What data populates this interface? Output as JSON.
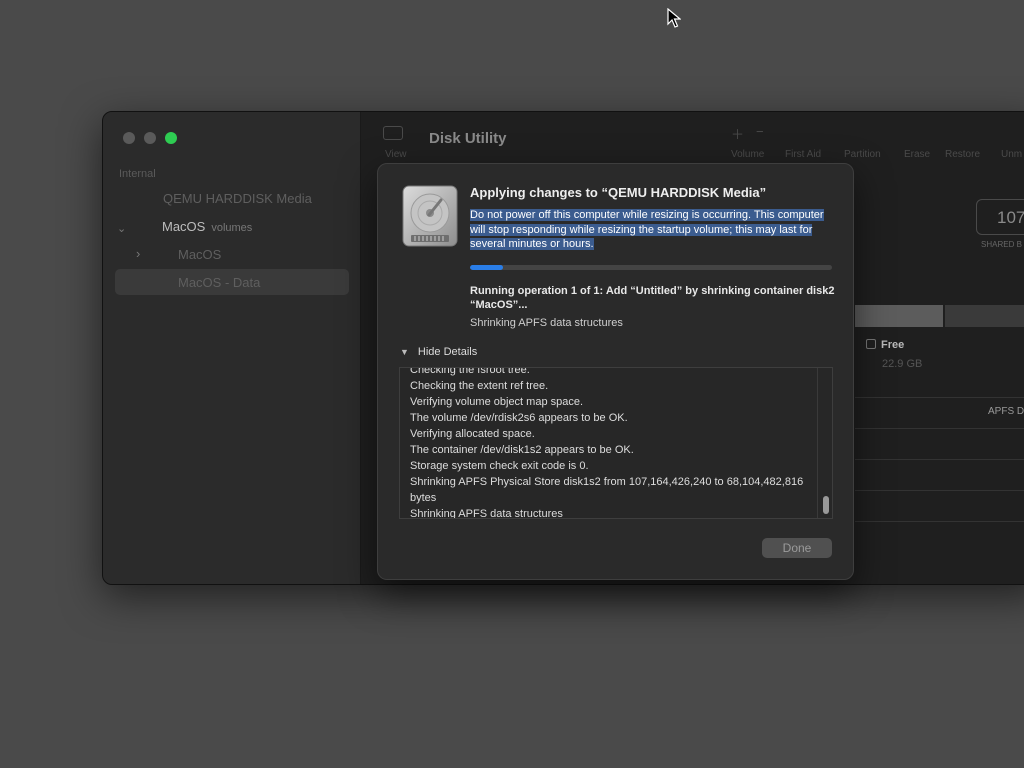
{
  "window": {
    "title": "Disk Utility",
    "toolbar": {
      "view_label": "View",
      "buttons": [
        "Volume",
        "First Aid",
        "Partition",
        "Erase",
        "Restore",
        "Unm"
      ]
    }
  },
  "sidebar": {
    "section": "Internal",
    "items": [
      {
        "label": "QEMU HARDDISK Media"
      },
      {
        "label": "MacOS",
        "sub": "volumes"
      },
      {
        "label": "MacOS"
      },
      {
        "label": "MacOS - Data"
      }
    ]
  },
  "main": {
    "capacity_value": "107",
    "capacity_label": "SHARED B",
    "free_label": "Free",
    "free_value": "22.9 GB",
    "type_value": "APFS D"
  },
  "sheet": {
    "title": "Applying changes to “QEMU HARDDISK Media”",
    "warning": "Do not power off this computer while resizing is occurring. This computer will stop responding while resizing the startup volume; this may last for several minutes or hours.",
    "progress_fraction": 0.09,
    "operation": "Running operation 1 of 1: Add “Untitled” by shrinking container disk2 “MacOS”...",
    "status": "Shrinking APFS data structures",
    "details_toggle": "Hide Details",
    "log": [
      "Checking the fsroot tree.",
      "Checking the extent ref tree.",
      "Verifying volume object map space.",
      "The volume /dev/rdisk2s6 appears to be OK.",
      "Verifying allocated space.",
      "The container /dev/disk1s2 appears to be OK.",
      "Storage system check exit code is 0.",
      "Shrinking APFS Physical Store disk1s2 from 107,164,426,240 to 68,104,482,816 bytes",
      "Shrinking APFS data structures"
    ],
    "done_label": "Done"
  },
  "colors": {
    "accent": "#2a7ee8",
    "selection": "#3b5c8f",
    "traffic_green": "#2ecc52"
  }
}
